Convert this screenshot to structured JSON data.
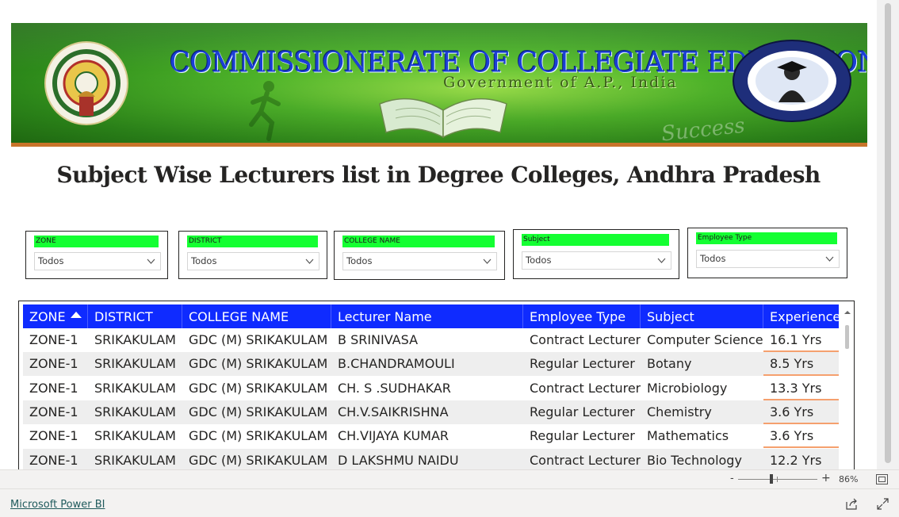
{
  "banner": {
    "title": "COMMISSIONERATE OF COLLEGIATE EDUCATION",
    "subtitle": "Government of A.P., India",
    "success_text": "Success"
  },
  "page_title": "Subject Wise Lecturers list in Degree Colleges, Andhra Pradesh",
  "slicers": [
    {
      "label": "ZONE",
      "value": "Todos"
    },
    {
      "label": "DISTRICT",
      "value": "Todos"
    },
    {
      "label": "COLLEGE NAME",
      "value": "Todos"
    },
    {
      "label": "Subject",
      "value": "Todos"
    },
    {
      "label": "Employee Type",
      "value": "Todos"
    }
  ],
  "table": {
    "columns": [
      "ZONE",
      "DISTRICT",
      "COLLEGE NAME",
      "Lecturer Name",
      "Employee Type",
      "Subject",
      "Experience"
    ],
    "sort": {
      "column": "ZONE",
      "direction": "ascending"
    },
    "rows": [
      [
        "ZONE-1",
        "SRIKAKULAM",
        "GDC (M) SRIKAKULAM",
        "B SRINIVASA",
        "Contract Lecturer",
        "Computer Science",
        "16.1 Yrs"
      ],
      [
        "ZONE-1",
        "SRIKAKULAM",
        "GDC (M) SRIKAKULAM",
        "B.CHANDRAMOULI",
        "Regular Lecturer",
        "Botany",
        "8.5 Yrs"
      ],
      [
        "ZONE-1",
        "SRIKAKULAM",
        "GDC (M) SRIKAKULAM",
        "CH. S .SUDHAKAR",
        "Contract Lecturer",
        "Microbiology",
        "13.3 Yrs"
      ],
      [
        "ZONE-1",
        "SRIKAKULAM",
        "GDC (M) SRIKAKULAM",
        "CH.V.SAIKRISHNA",
        "Regular Lecturer",
        "Chemistry",
        "3.6 Yrs"
      ],
      [
        "ZONE-1",
        "SRIKAKULAM",
        "GDC (M) SRIKAKULAM",
        "CH.VIJAYA KUMAR",
        "Regular Lecturer",
        "Mathematics",
        "3.6 Yrs"
      ],
      [
        "ZONE-1",
        "SRIKAKULAM",
        "GDC (M) SRIKAKULAM",
        "D LAKSHMU NAIDU",
        "Contract Lecturer",
        "Bio Technology",
        "12.2 Yrs"
      ]
    ]
  },
  "zoom": {
    "minus": "-",
    "plus": "+",
    "level": "86%"
  },
  "footer": {
    "link": "Microsoft Power BI"
  },
  "colors": {
    "header_blue": "#0f2bff",
    "slicer_green": "#14ff32",
    "experience_underline": "#f5a06e",
    "banner_border": "#c8742a"
  },
  "icons": [
    "ap-emblem-icon",
    "cce-seal-icon",
    "open-book-icon",
    "runner-icon",
    "chevron-down-icon",
    "sort-ascending-icon",
    "scroll-up-icon",
    "fit-to-page-icon",
    "share-icon",
    "fullscreen-icon"
  ]
}
